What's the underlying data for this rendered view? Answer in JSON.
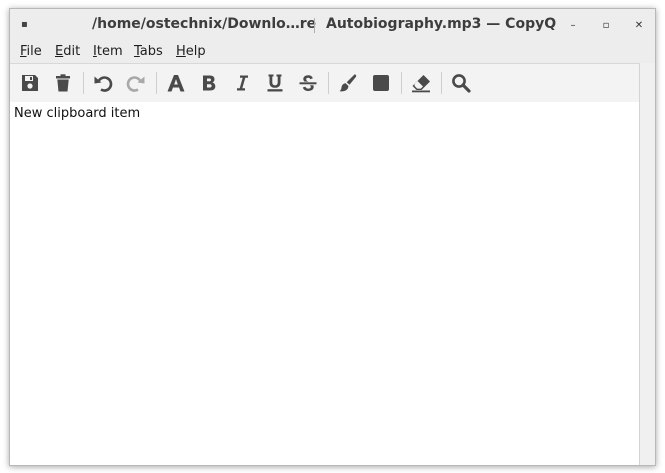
{
  "window": {
    "title_left": "/home/ostechnix/Downlo…re",
    "title_right": "Autobiography.mp3 — CopyQ"
  },
  "window_controls": {
    "menu": "▪",
    "minimize": "–",
    "maximize": "▫",
    "close": "✕"
  },
  "menubar": {
    "items": [
      {
        "mnemonic": "F",
        "rest": "ile"
      },
      {
        "mnemonic": "E",
        "rest": "dit"
      },
      {
        "mnemonic": "I",
        "rest": "tem"
      },
      {
        "mnemonic": "T",
        "rest": "abs"
      },
      {
        "mnemonic": "H",
        "rest": "elp"
      }
    ]
  },
  "toolbar": {
    "icons": [
      "save-icon",
      "trash-icon",
      "undo-icon",
      "redo-icon",
      "font-icon",
      "bold-icon",
      "italic-icon",
      "underline-icon",
      "strikethrough-icon",
      "brush-icon",
      "background-color-icon",
      "eraser-icon",
      "search-icon"
    ],
    "icon_color": "#4a4a4a",
    "disabled_color": "#a8a8a8"
  },
  "editor": {
    "text": "New clipboard item"
  }
}
